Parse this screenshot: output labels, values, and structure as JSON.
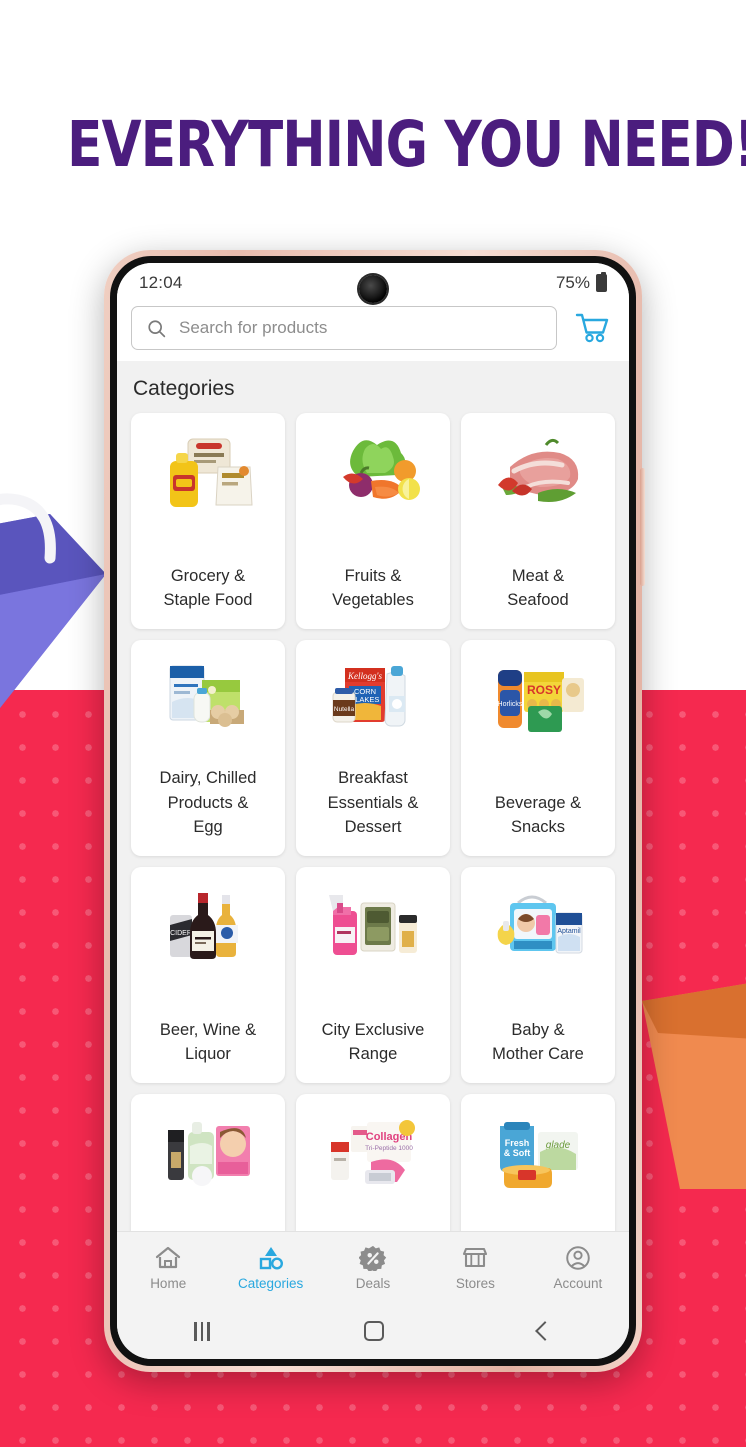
{
  "promo": {
    "headline": "EVERYTHING YOU NEED!",
    "headline_color": "#4b1d7e",
    "background_top_color": "#ffffff",
    "background_bottom_color": "#f5294f",
    "decor": [
      {
        "name": "shopping-bag-purple",
        "color": "#6f6ad4"
      },
      {
        "name": "shopping-bag-orange",
        "color": "#f08a4f"
      }
    ]
  },
  "device": {
    "frame_color": "#eec7b8",
    "status_bar": {
      "time": "12:04",
      "battery_percent": "75%",
      "battery_icon": "battery-icon",
      "camera": "front-camera-punch-hole"
    },
    "android_nav": {
      "recents_label": "recents-icon",
      "home_label": "home-icon",
      "back_label": "back-icon"
    }
  },
  "app": {
    "accent_color": "#29a8df",
    "search": {
      "placeholder": "Search for products",
      "value": "",
      "icon": "search-icon"
    },
    "cart": {
      "icon": "shopping-cart-icon",
      "color": "#29a8df"
    },
    "section_title": "Categories",
    "categories": [
      {
        "label": "Grocery &\nStaple Food",
        "image": "grocery-staple-food-products"
      },
      {
        "label": "Fruits &\nVegetables",
        "image": "fruits-vegetables-products"
      },
      {
        "label": "Meat &\nSeafood",
        "image": "meat-seafood-products"
      },
      {
        "label": "Dairy, Chilled\nProducts &\nEgg",
        "image": "dairy-chilled-egg-products"
      },
      {
        "label": "Breakfast\nEssentials &\nDessert",
        "image": "breakfast-essentials-dessert-products"
      },
      {
        "label": "Beverage &\nSnacks",
        "image": "beverage-snacks-products"
      },
      {
        "label": "Beer, Wine &\nLiquor",
        "image": "beer-wine-liquor-products"
      },
      {
        "label": "City Exclusive\nRange",
        "image": "city-exclusive-range-products"
      },
      {
        "label": "Baby &\nMother Care",
        "image": "baby-mother-care-products"
      },
      {
        "label": "",
        "image": "beauty-personal-care-products"
      },
      {
        "label": "",
        "image": "health-wellness-products"
      },
      {
        "label": "",
        "image": "household-cleaning-products"
      }
    ],
    "bottom_nav": [
      {
        "label": "Home",
        "icon": "home-icon",
        "active": false
      },
      {
        "label": "Categories",
        "icon": "categories-icon",
        "active": true
      },
      {
        "label": "Deals",
        "icon": "deals-badge-icon",
        "active": false
      },
      {
        "label": "Stores",
        "icon": "store-icon",
        "active": false
      },
      {
        "label": "Account",
        "icon": "account-icon",
        "active": false
      }
    ]
  }
}
